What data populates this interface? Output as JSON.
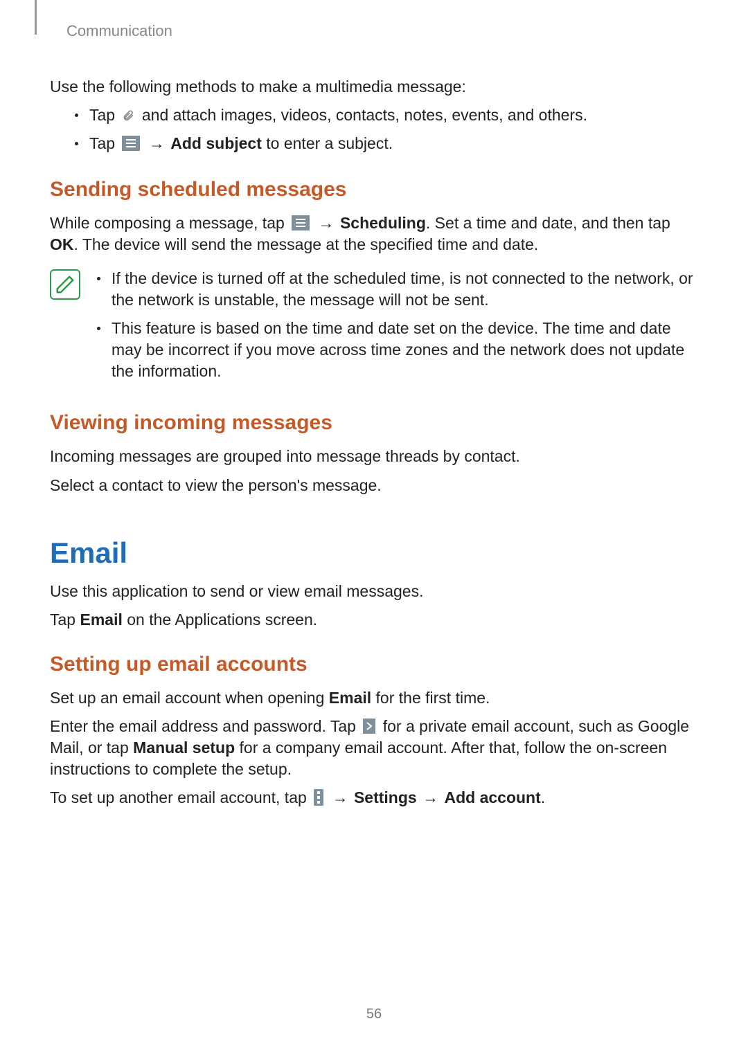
{
  "header": {
    "section": "Communication"
  },
  "page_number": "56",
  "intro_p1": "Use the following methods to make a multimedia message:",
  "bullets1": {
    "b1_pre": "Tap ",
    "b1_post": " and attach images, videos, contacts, notes, events, and others.",
    "b2_pre": "Tap ",
    "b2_arrow": " → ",
    "b2_bold": "Add subject",
    "b2_post": " to enter a subject."
  },
  "h2_scheduled": "Sending scheduled messages",
  "scheduled_p": {
    "pre": "While composing a message, tap ",
    "arrow": " → ",
    "bold1": "Scheduling",
    "mid": ". Set a time and date, and then tap ",
    "bold2": "OK",
    "post": ". The device will send the message at the specified time and date."
  },
  "note_bullets": {
    "n1": "If the device is turned off at the scheduled time, is not connected to the network, or the network is unstable, the message will not be sent.",
    "n2": "This feature is based on the time and date set on the device. The time and date may be incorrect if you move across time zones and the network does not update the information."
  },
  "h2_viewing": "Viewing incoming messages",
  "viewing_p1": "Incoming messages are grouped into message threads by contact.",
  "viewing_p2": "Select a contact to view the person's message.",
  "h1_email": "Email",
  "email_p1": "Use this application to send or view email messages.",
  "email_p2_pre": "Tap ",
  "email_p2_bold": "Email",
  "email_p2_post": " on the Applications screen.",
  "h2_setup": "Setting up email accounts",
  "setup_p1_pre": "Set up an email account when opening ",
  "setup_p1_bold": "Email",
  "setup_p1_post": " for the first time.",
  "setup_p2": {
    "pre": "Enter the email address and password. Tap ",
    "mid1": " for a private email account, such as Google Mail, or tap ",
    "bold1": "Manual setup",
    "post": " for a company email account. After that, follow the on-screen instructions to complete the setup."
  },
  "setup_p3": {
    "pre": "To set up another email account, tap ",
    "arrow": " → ",
    "bold1": "Settings",
    "arrow2": " → ",
    "bold2": "Add account",
    "post": "."
  }
}
